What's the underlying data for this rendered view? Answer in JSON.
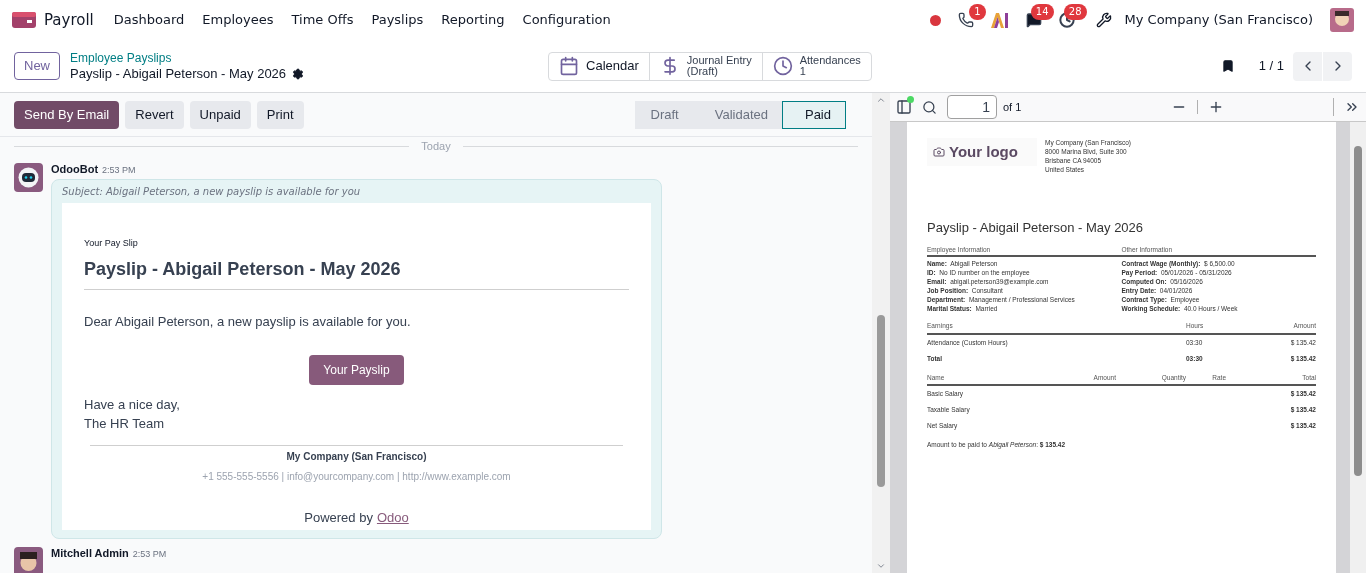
{
  "app": {
    "name": "Payroll"
  },
  "menu": [
    "Dashboard",
    "Employees",
    "Time Offs",
    "Payslips",
    "Reporting",
    "Configuration"
  ],
  "systray": {
    "phone_badge": "1",
    "chat_badge": "14",
    "activity_badge": "28",
    "company": "My Company (San Francisco)"
  },
  "breadcrumb": {
    "new_button": "New",
    "parent": "Employee Payslips",
    "title": "Payslip - Abigail Peterson - May 2026"
  },
  "smart_buttons": [
    {
      "kind": "calendar",
      "label": "Calendar"
    },
    {
      "kind": "journal",
      "label": "Journal Entry",
      "value": "(Draft)"
    },
    {
      "kind": "attendance",
      "label": "Attendances",
      "value": "1"
    }
  ],
  "pager": "1 / 1",
  "actions": [
    {
      "label": "Send By Email",
      "primary": true
    },
    {
      "label": "Revert",
      "primary": false
    },
    {
      "label": "Unpaid",
      "primary": false
    },
    {
      "label": "Print",
      "primary": false
    }
  ],
  "stages": [
    {
      "label": "Draft",
      "selected": false
    },
    {
      "label": "Validated",
      "selected": false
    },
    {
      "label": "Paid",
      "selected": true
    }
  ],
  "chatter": {
    "date_separator": "Today",
    "messages": [
      {
        "kind": "bot",
        "author": "OdooBot",
        "time": "2:53 PM",
        "subject": "Subject: Abigail Peterson, a new payslip is available for you",
        "email": {
          "pretitle": "Your Pay Slip",
          "title": "Payslip - Abigail Peterson - May 2026",
          "greeting": "Dear Abigail Peterson, a new payslip is available for you.",
          "button": "Your Payslip",
          "closing": [
            "Have a nice day,",
            "The HR Team"
          ],
          "company": "My Company (San Francisco)",
          "contacts": "+1 555-555-5556 | info@yourcompany.com | http://www.example.com",
          "powered_by": "Powered by",
          "powered_link": "Odoo"
        }
      },
      {
        "kind": "user",
        "author": "Mitchell Admin",
        "time": "2:53 PM"
      }
    ]
  },
  "pdf": {
    "page": "1",
    "page_count": "of 1",
    "document": {
      "logo": "Your logo",
      "address": [
        "My Company (San Francisco)",
        "8000 Marina Blvd, Suite 300",
        "Brisbane CA 94005",
        "United States"
      ],
      "title": "Payslip - Abigail Peterson - May 2026",
      "info_headings": [
        "Employee Information",
        "Other Information"
      ],
      "employee_info": [
        {
          "label": "Name:",
          "value": "Abigail Peterson"
        },
        {
          "label": "ID:",
          "value": "No ID number on the employee"
        },
        {
          "label": "Email:",
          "value": "abigail.peterson39@example.com"
        },
        {
          "label": "Job Position:",
          "value": "Consultant"
        },
        {
          "label": "Department:",
          "value": "Management / Professional Services"
        },
        {
          "label": "Marital Status:",
          "value": "Married"
        }
      ],
      "other_info": [
        {
          "label": "Contract Wage (Monthly):",
          "value": "$ 6,500.00"
        },
        {
          "label": "Pay Period:",
          "value": "05/01/2026 - 05/31/2026"
        },
        {
          "label": "Computed On:",
          "value": "05/16/2026"
        },
        {
          "label": "Entry Date:",
          "value": "04/01/2026"
        },
        {
          "label": "Contract Type:",
          "value": "Employee"
        },
        {
          "label": "Working Schedule:",
          "value": "40.0 Hours / Week"
        }
      ],
      "earnings": {
        "columns": [
          "Earnings",
          "Hours",
          "Amount"
        ],
        "rows": [
          {
            "cells": [
              "Attendance (Custom Hours)",
              "03:30",
              "$ 135.42"
            ],
            "bold": false
          },
          {
            "cells": [
              "Total",
              "03:30",
              "$ 135.42"
            ],
            "bold": true
          }
        ]
      },
      "lines": {
        "columns": [
          "Name",
          "Amount",
          "Quantity",
          "Rate",
          "Total"
        ],
        "rows": [
          {
            "name": "Basic Salary",
            "total": "$ 135.42"
          },
          {
            "name": "Taxable Salary",
            "total": "$ 135.42"
          },
          {
            "name": "Net Salary",
            "total": "$ 135.42"
          }
        ]
      },
      "footer": "Amount to be paid to *Abigail Peterson*: **$ 135.42**"
    }
  }
}
